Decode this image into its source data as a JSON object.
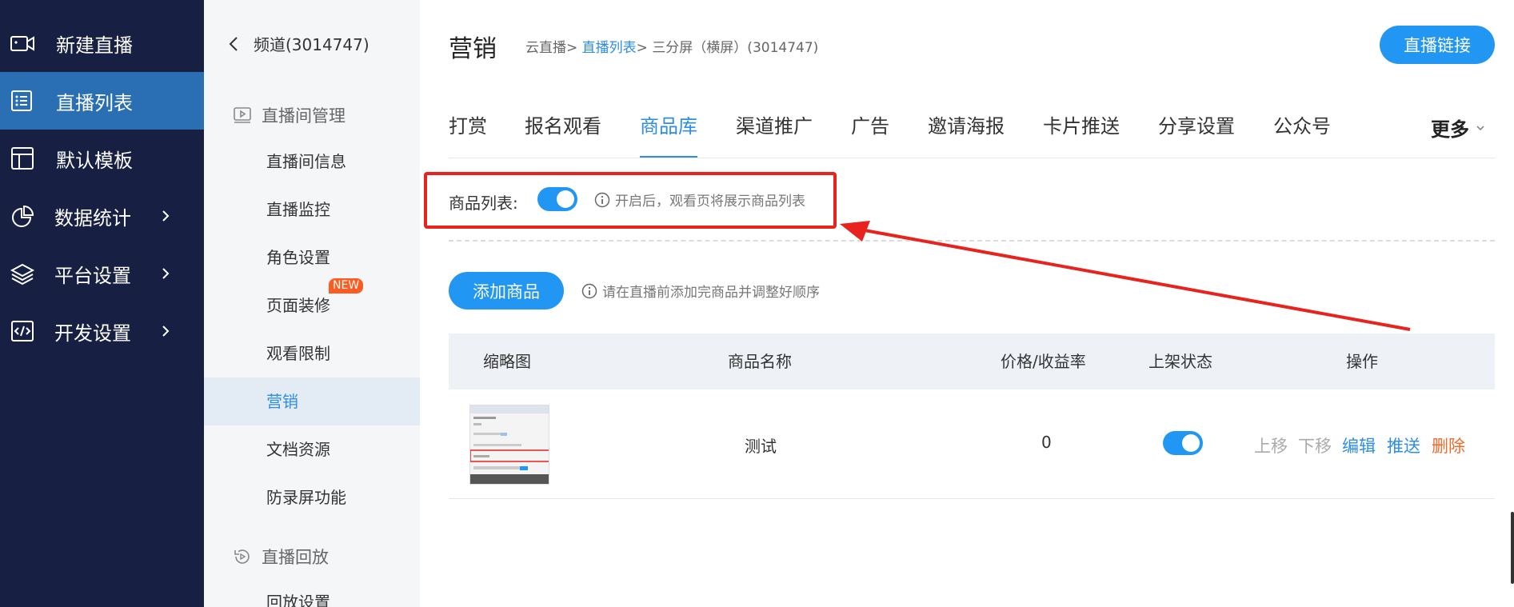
{
  "nav": {
    "items": [
      {
        "label": "新建直播",
        "icon": "video-camera-icon"
      },
      {
        "label": "直播列表",
        "icon": "list-icon"
      },
      {
        "label": "默认模板",
        "icon": "layout-template-icon"
      },
      {
        "label": "数据统计",
        "icon": "pie-chart-icon"
      },
      {
        "label": "平台设置",
        "icon": "layers-icon"
      },
      {
        "label": "开发设置",
        "icon": "code-icon"
      }
    ]
  },
  "subnav": {
    "back_label": "频道(3014747)",
    "section_room": "直播间管理",
    "items": [
      "直播间信息",
      "直播监控",
      "角色设置",
      "页面装修",
      "观看限制",
      "营销",
      "文档资源",
      "防录屏功能"
    ],
    "new_badge": "NEW",
    "section_replay": "直播回放",
    "replay_item": "回放设置"
  },
  "header": {
    "title": "营销",
    "crumb_root": "云直播",
    "crumb_list": "直播列表",
    "crumb_current": "三分屏（横屏）(3014747)",
    "crumb_sep": ">",
    "live_link_button": "直播链接"
  },
  "tabs": [
    "打赏",
    "报名观看",
    "商品库",
    "渠道推广",
    "广告",
    "邀请海报",
    "卡片推送",
    "分享设置",
    "公众号"
  ],
  "tabs_more": "更多",
  "product_list": {
    "label": "商品列表:",
    "enabled": true,
    "hint": "开启后，观看页将展示商品列表"
  },
  "add_product": {
    "button": "添加商品",
    "hint": "请在直播前添加完商品并调整好顺序"
  },
  "table": {
    "headers": [
      "缩略图",
      "商品名称",
      "价格/收益率",
      "上架状态",
      "操作"
    ],
    "rows": [
      {
        "name": "测试",
        "price": "0",
        "on_shelf": true,
        "actions": {
          "up": "上移",
          "down": "下移",
          "edit": "编辑",
          "push": "推送",
          "delete": "删除"
        }
      }
    ]
  },
  "colors": {
    "accent": "#2196f3",
    "nav_bg": "#172043",
    "nav_active": "#2a6fb3",
    "danger": "#e8221c",
    "delete": "#f06a2b"
  }
}
